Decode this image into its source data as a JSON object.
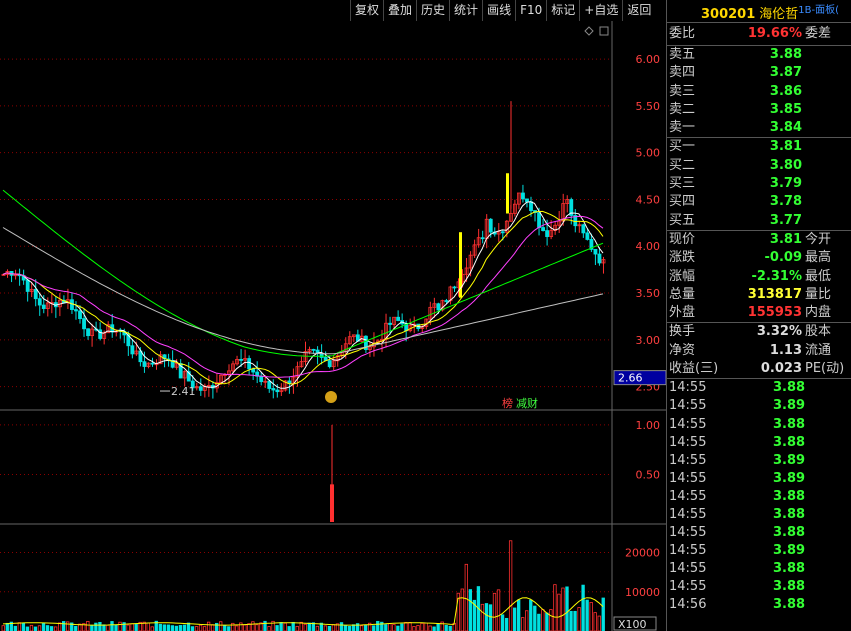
{
  "toolbar": {
    "items": [
      "复权",
      "叠加",
      "历史",
      "统计",
      "画线",
      "F10",
      "标记",
      "+自选",
      "返回"
    ]
  },
  "stock": {
    "code": "300201",
    "name": "海伦哲",
    "tag": "1B-面板("
  },
  "order_book": {
    "ratio_label": "委比",
    "ratio_value": "19.66%",
    "diff_label": "委差",
    "asks": [
      {
        "label": "卖五",
        "price": "3.88"
      },
      {
        "label": "卖四",
        "price": "3.87"
      },
      {
        "label": "卖三",
        "price": "3.86"
      },
      {
        "label": "卖二",
        "price": "3.85"
      },
      {
        "label": "卖一",
        "price": "3.84"
      }
    ],
    "bids": [
      {
        "label": "买一",
        "price": "3.81"
      },
      {
        "label": "买二",
        "price": "3.80"
      },
      {
        "label": "买三",
        "price": "3.79"
      },
      {
        "label": "买四",
        "price": "3.78"
      },
      {
        "label": "买五",
        "price": "3.77"
      }
    ]
  },
  "quote": [
    {
      "label": "现价",
      "value": "3.81",
      "label2": "今开",
      "color": "#3f3"
    },
    {
      "label": "涨跌",
      "value": "-0.09",
      "label2": "最高",
      "color": "#3f3"
    },
    {
      "label": "涨幅",
      "value": "-2.31%",
      "label2": "最低",
      "color": "#3f3"
    },
    {
      "label": "总量",
      "value": "313817",
      "label2": "量比",
      "color": "#ff3"
    },
    {
      "label": "外盘",
      "value": "155953",
      "label2": "内盘",
      "color": "#f33"
    }
  ],
  "fundamentals": [
    {
      "label": "换手",
      "value": "3.32%",
      "label2": "股本"
    },
    {
      "label": "净资",
      "value": "1.13",
      "label2": "流通"
    },
    {
      "label": "收益(三)",
      "value": "0.023",
      "label2": "PE(动)"
    }
  ],
  "ticks": [
    {
      "time": "14:55",
      "price": "3.88"
    },
    {
      "time": "14:55",
      "price": "3.89"
    },
    {
      "time": "14:55",
      "price": "3.88"
    },
    {
      "time": "14:55",
      "price": "3.88"
    },
    {
      "time": "14:55",
      "price": "3.89"
    },
    {
      "time": "14:55",
      "price": "3.89"
    },
    {
      "time": "14:55",
      "price": "3.88"
    },
    {
      "time": "14:55",
      "price": "3.88"
    },
    {
      "time": "14:55",
      "price": "3.88"
    },
    {
      "time": "14:55",
      "price": "3.89"
    },
    {
      "time": "14:55",
      "price": "3.88"
    },
    {
      "time": "14:55",
      "price": "3.88"
    },
    {
      "time": "14:56",
      "price": "3.88"
    }
  ],
  "chart_data": {
    "type": "line",
    "price_axis": {
      "ticks": [
        "6.00",
        "5.50",
        "5.00",
        "4.50",
        "4.00",
        "3.50",
        "3.00",
        "2.50"
      ],
      "ylim": [
        2.25,
        6.3
      ]
    },
    "current_price_label": "2.66",
    "low_annotation": "2.41",
    "badges": [
      "榜",
      "减财"
    ],
    "indicator_axis": {
      "ticks": [
        "1.00",
        "0.50"
      ],
      "ylim": [
        0,
        1.1
      ],
      "spike_value": 1.0
    },
    "volume_axis": {
      "ticks": [
        "20000",
        "10000"
      ],
      "unit_label": "X100"
    },
    "colors": {
      "up": "#ff3030",
      "down": "#00e0e0",
      "ma5": "#ffffff",
      "ma10": "#ffff00",
      "ma20": "#ff40ff",
      "ma60": "#00ff00",
      "ma120": "#c0c0c0",
      "grid": "#8b0000"
    }
  }
}
